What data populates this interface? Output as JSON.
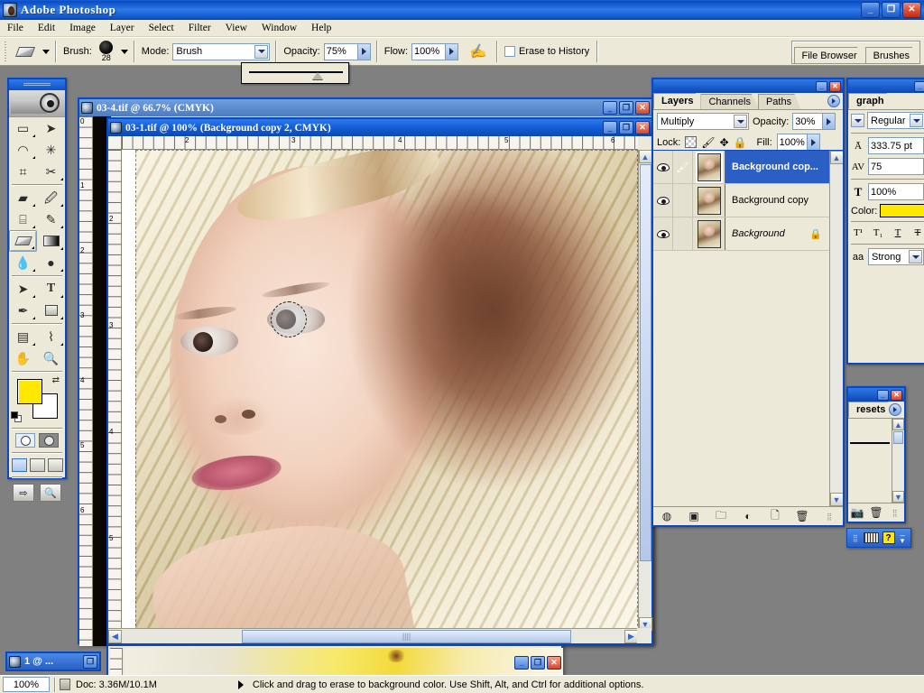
{
  "app": {
    "title": "Adobe Photoshop",
    "icon": "photoshop-icon",
    "window_controls": {
      "minimize": "_",
      "restore": "❐",
      "close": "✕"
    }
  },
  "menu": {
    "items": [
      "File",
      "Edit",
      "Image",
      "Layer",
      "Select",
      "Filter",
      "View",
      "Window",
      "Help"
    ]
  },
  "options_bar": {
    "tool_icon": "eraser-icon",
    "brush_label": "Brush:",
    "brush_size": "28",
    "mode_label": "Mode:",
    "mode_value": "Brush",
    "opacity_label": "Opacity:",
    "opacity_value": "75%",
    "flow_label": "Flow:",
    "flow_value": "100%",
    "airbrush_icon": "airbrush-icon",
    "erase_to_history_label": "Erase to History",
    "erase_to_history_checked": false,
    "doc_list_icon": "palette-well-icon",
    "well_tabs": [
      "File Browser",
      "Brushes"
    ]
  },
  "opacity_popup": {
    "visible": true,
    "value": "75%"
  },
  "toolbox": {
    "tools": [
      {
        "name": "marquee-tool",
        "glyph": "▭"
      },
      {
        "name": "move-tool",
        "glyph": "➤"
      },
      {
        "name": "lasso-tool",
        "glyph": "◯"
      },
      {
        "name": "magic-wand-tool",
        "glyph": "✳"
      },
      {
        "name": "crop-tool",
        "glyph": "⌗"
      },
      {
        "name": "slice-tool",
        "glyph": "✂"
      },
      {
        "name": "healing-brush-tool",
        "glyph": "▰"
      },
      {
        "name": "brush-tool",
        "glyph": "🖌"
      },
      {
        "name": "clone-stamp-tool",
        "glyph": "⌷"
      },
      {
        "name": "history-brush-tool",
        "glyph": "✎"
      },
      {
        "name": "eraser-tool",
        "glyph": "▱",
        "selected": true
      },
      {
        "name": "gradient-tool",
        "glyph": "▤"
      },
      {
        "name": "blur-tool",
        "glyph": "💧"
      },
      {
        "name": "dodge-tool",
        "glyph": "●"
      },
      {
        "name": "path-selection-tool",
        "glyph": "➤"
      },
      {
        "name": "type-tool",
        "glyph": "T"
      },
      {
        "name": "pen-tool",
        "glyph": "✒"
      },
      {
        "name": "shape-tool",
        "glyph": "▢"
      },
      {
        "name": "notes-tool",
        "glyph": "▤"
      },
      {
        "name": "eyedropper-tool",
        "glyph": "⌇"
      },
      {
        "name": "hand-tool",
        "glyph": "✋"
      },
      {
        "name": "zoom-tool",
        "glyph": "🔍"
      }
    ],
    "foreground_color": "#ffe800",
    "background_color": "#ffffff",
    "swap_icon": "swap-colors-icon",
    "default_colors_icon": "default-colors-icon",
    "quick_mask_modes": [
      "standard-mask-mode",
      "quick-mask-mode"
    ],
    "screen_modes": [
      "standard-screen-mode",
      "full-screen-menubar-mode",
      "full-screen-mode"
    ],
    "jump_to_imageready": "jump-to-imageready-icon"
  },
  "documents": [
    {
      "name": "doc-window-back",
      "title": "03-4.tif @ 66.7% (CMYK)",
      "active": false
    },
    {
      "name": "doc-window-front",
      "title": "03-1.tif @ 100% (Background copy 2, CMYK)",
      "active": true,
      "ruler_h_ticks": [
        "2",
        "3",
        "4",
        "5",
        "6"
      ],
      "ruler_v_ticks": [
        "2",
        "3",
        "4",
        "5"
      ]
    },
    {
      "name": "doc-window-bottom",
      "title": "",
      "active": false
    }
  ],
  "minimized_window": {
    "title": "1 @ ..."
  },
  "layers_palette": {
    "tabs": [
      "Layers",
      "Channels",
      "Paths"
    ],
    "active_tab": "Layers",
    "blend_mode": "Multiply",
    "opacity_label": "Opacity:",
    "opacity_value": "30%",
    "lock_label": "Lock:",
    "lock_icons": [
      "lock-transparency-icon",
      "lock-image-icon",
      "lock-position-icon",
      "lock-all-icon"
    ],
    "fill_label": "Fill:",
    "fill_value": "100%",
    "layers": [
      {
        "name": "Background cop...",
        "selected": true,
        "visible": true,
        "locked": false,
        "italic": false,
        "has_brush_icon": true
      },
      {
        "name": "Background copy",
        "selected": false,
        "visible": true,
        "locked": false,
        "italic": false,
        "has_brush_icon": false
      },
      {
        "name": "Background",
        "selected": false,
        "visible": true,
        "locked": true,
        "italic": true,
        "has_brush_icon": false
      }
    ],
    "bottom_buttons": [
      "layer-style-icon",
      "layer-mask-icon",
      "new-group-icon",
      "adjustment-layer-icon",
      "new-layer-icon",
      "delete-layer-icon"
    ]
  },
  "character_palette": {
    "tab": "graph",
    "font_style": "Regular",
    "leading_value": "333.75 pt",
    "tracking_value": "75",
    "vertical_scale_value": "100%",
    "color_label": "Color:",
    "color_value": "#ffe800",
    "type_buttons": [
      "superscript-icon",
      "subscript-icon",
      "underline-icon",
      "strikethrough-icon"
    ],
    "antialias_label": "aa",
    "antialias_value": "Strong"
  },
  "presets_palette": {
    "tab": "resets",
    "bottom_buttons": [
      "new-preset-icon",
      "delete-preset-icon"
    ]
  },
  "mini_toolbar": {
    "buttons": [
      "keyboard-icon",
      "help-icon",
      "resize-icon"
    ]
  },
  "status_bar": {
    "zoom": "100%",
    "doc_icon": "document-size-icon",
    "doc_info": "Doc: 3.36M/10.1M",
    "hint": "Click and drag to erase to background color.  Use Shift, Alt, and Ctrl for additional options."
  }
}
